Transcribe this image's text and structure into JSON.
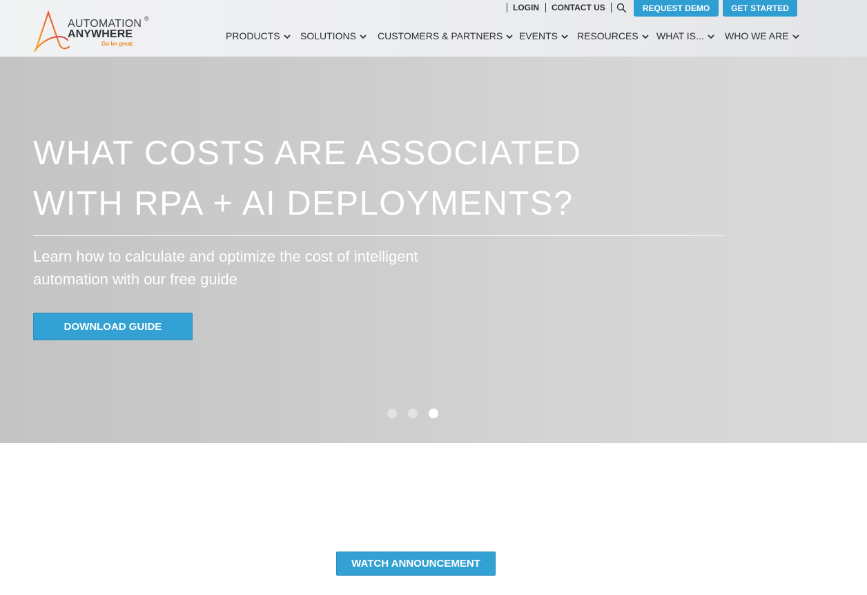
{
  "brand": {
    "line1": "AUTOMATION",
    "line2": "ANYWHERE",
    "tagline": "Go be great.",
    "registered": "®",
    "logo_colors": [
      "#f7a823",
      "#e8552b",
      "#d12a5b"
    ]
  },
  "utility_nav": {
    "login": "LOGIN",
    "contact": "CONTACT US",
    "search_icon": "search-icon",
    "request_demo": "REQUEST DEMO",
    "get_started": "GET STARTED"
  },
  "main_nav": {
    "items": [
      {
        "label": "PRODUCTS"
      },
      {
        "label": "SOLUTIONS"
      },
      {
        "label": "CUSTOMERS & PARTNERS"
      },
      {
        "label": "EVENTS"
      },
      {
        "label": "RESOURCES"
      },
      {
        "label": "WHAT IS..."
      },
      {
        "label": "WHO WE ARE"
      }
    ]
  },
  "hero": {
    "title_line1": "WHAT COSTS ARE ASSOCIATED",
    "title_line2": "WITH RPA + AI DEPLOYMENTS?",
    "subtitle_line1": "Learn how to calculate and optimize the cost of intelligent",
    "subtitle_line2": "automation with our free guide",
    "cta": "DOWNLOAD GUIDE",
    "carousel": {
      "slides": 3,
      "active_index": 2
    }
  },
  "secondary_cta": "WATCH ANNOUNCEMENT",
  "colors": {
    "accent": "#33a1d4",
    "header_bg": "#eceded",
    "hero_bg": "#cdcdcd",
    "text_dark": "#2b2e33"
  }
}
